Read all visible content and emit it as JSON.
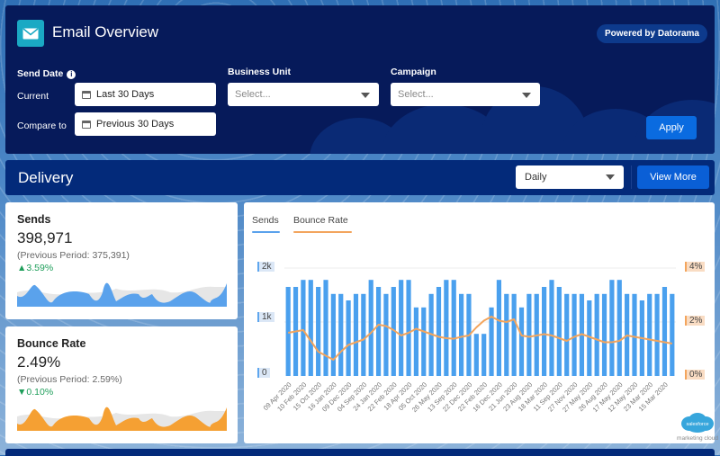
{
  "header": {
    "app_title": "Email Overview",
    "app_icon": "envelope-icon",
    "powered_by": "Powered by Datorama"
  },
  "filters": {
    "send_date_label": "Send Date",
    "info_glyph": "i",
    "current_label": "Current",
    "current_value": "Last 30 Days",
    "compare_label": "Compare to",
    "compare_value": "Previous 30 Days",
    "business_unit_label": "Business Unit",
    "business_unit_placeholder": "Select...",
    "campaign_label": "Campaign",
    "campaign_placeholder": "Select...",
    "apply_label": "Apply"
  },
  "delivery": {
    "title": "Delivery",
    "granularity": "Daily",
    "view_more_label": "View More"
  },
  "kpis": [
    {
      "title": "Sends",
      "value": "398,971",
      "previous": "(Previous Period: 375,391)",
      "delta": "▲3.59%",
      "color": "#5aa2ec"
    },
    {
      "title": "Bounce Rate",
      "value": "2.49%",
      "previous": "(Previous Period: 2.59%)",
      "delta": "▼0.10%",
      "color": "#f5a033"
    }
  ],
  "colors": {
    "sends": "#4aa0ee",
    "bounce": "#f3a55d",
    "positive": "#1e9e5a",
    "header_bg": "#061a5a",
    "accent_button": "#0a6be0"
  },
  "logo": {
    "brand": "salesforce",
    "sub": "marketing cloud"
  },
  "chart_data": {
    "type": "bar",
    "title": "",
    "tabs": [
      "Sends",
      "Bounce Rate"
    ],
    "xlabel": "",
    "ylabel": "",
    "y_left": {
      "ticks": [
        "0",
        "1k",
        "2k"
      ],
      "range": [
        0,
        2000
      ]
    },
    "y_right": {
      "ticks": [
        "0%",
        "2%",
        "4%"
      ],
      "range": [
        0,
        4
      ]
    },
    "grid": true,
    "x_labels": [
      "09 Apr 2020",
      "10 Feb 2020",
      "15 Oct 2020",
      "16 Jan 2020",
      "09 Dec 2020",
      "04 Sep 2020",
      "24 Jan 2020",
      "22 Feb 2020",
      "18 Apr 2020",
      "05 Oct 2020",
      "26 May 2020",
      "13 Sep 2020",
      "22 Dec 2020",
      "22 Feb 2020",
      "16 Dec 2020",
      "21 Jun 2020",
      "23 Aug 2020",
      "18 Mar 2020",
      "11 Sep 2020",
      "27 Nov 2020",
      "27 May 2020",
      "26 Aug 2020",
      "17 May 2020",
      "12 May 2020",
      "23 Mar 2020",
      "15 Mar 2020"
    ],
    "series": [
      {
        "name": "Sends",
        "type": "bar",
        "axis": "left",
        "values": [
          1650,
          1650,
          1780,
          1780,
          1650,
          1780,
          1520,
          1520,
          1400,
          1520,
          1520,
          1780,
          1650,
          1520,
          1650,
          1780,
          1780,
          1270,
          1270,
          1520,
          1650,
          1780,
          1780,
          1520,
          1520,
          780,
          780,
          1270,
          1780,
          1520,
          1520,
          1270,
          1520,
          1520,
          1650,
          1780,
          1650,
          1520,
          1520,
          1520,
          1400,
          1520,
          1520,
          1780,
          1780,
          1520,
          1520,
          1400,
          1520,
          1520,
          1650,
          1520
        ]
      },
      {
        "name": "Bounce Rate",
        "type": "line",
        "axis": "right",
        "values": [
          1.6,
          1.65,
          1.7,
          1.3,
          0.9,
          0.75,
          0.6,
          0.9,
          1.15,
          1.25,
          1.35,
          1.6,
          1.9,
          1.85,
          1.7,
          1.5,
          1.6,
          1.75,
          1.65,
          1.55,
          1.45,
          1.4,
          1.38,
          1.45,
          1.5,
          1.8,
          2.05,
          2.2,
          2.05,
          2.0,
          2.1,
          1.5,
          1.45,
          1.5,
          1.55,
          1.5,
          1.4,
          1.3,
          1.45,
          1.55,
          1.45,
          1.35,
          1.25,
          1.25,
          1.3,
          1.5,
          1.45,
          1.4,
          1.35,
          1.3,
          1.25,
          1.2
        ]
      }
    ]
  }
}
